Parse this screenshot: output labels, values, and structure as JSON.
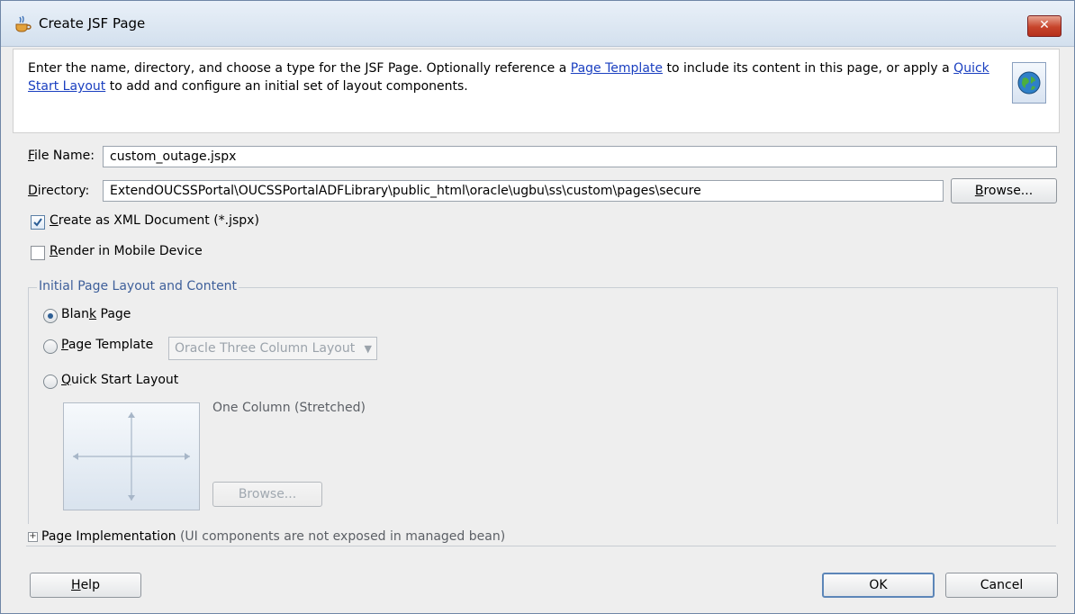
{
  "window": {
    "title": "Create JSF Page",
    "close_label": "✕"
  },
  "header": {
    "text_1": "Enter the name, directory, and choose a type for the JSF Page. Optionally reference a ",
    "link_page_template": "Page Template",
    "text_2": " to include its content in this page, or apply a ",
    "link_quick_start": "Quick Start Layout",
    "text_3": " to add and configure an initial set of layout components."
  },
  "file_name": {
    "label": "File Name:",
    "value": "custom_outage.jspx"
  },
  "directory": {
    "label": "Directory:",
    "value": "ExtendOUCSSPortal\\OUCSSPortalADFLibrary\\public_html\\oracle\\ugbu\\ss\\custom\\pages\\secure",
    "browse_label": "Browse..."
  },
  "options": {
    "xml_document": {
      "label": "Create as XML Document (*.jspx)",
      "checked": true
    },
    "mobile": {
      "label": "Render in Mobile Device",
      "checked": false
    }
  },
  "layout_group": {
    "title": "Initial Page Layout and Content",
    "blank_page": {
      "label": "Blank Page",
      "selected": true
    },
    "page_template": {
      "label": "Page Template",
      "selected": false,
      "select_value": "Oracle Three Column Layout"
    },
    "quick_start": {
      "label": "Quick Start Layout",
      "selected": false,
      "layout_name": "One Column (Stretched)",
      "browse_label": "Browse..."
    }
  },
  "implementation": {
    "label": "Page Implementation",
    "note": "(UI components are not exposed in managed bean)"
  },
  "footer": {
    "help_label": "Help",
    "ok_label": "OK",
    "cancel_label": "Cancel"
  },
  "colors": {
    "accent": "#3e5f9a",
    "link": "#1a3fc0",
    "close": "#c7442b"
  }
}
